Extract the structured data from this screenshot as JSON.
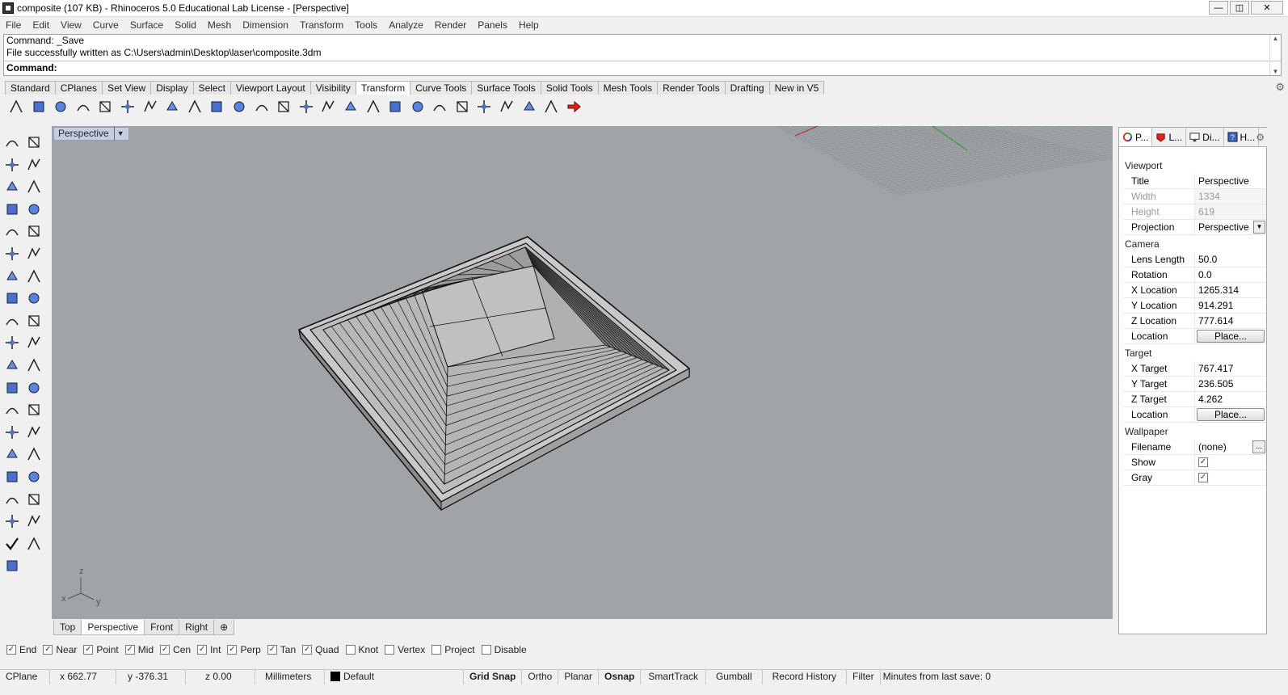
{
  "window": {
    "title": "composite (107 KB) - Rhinoceros 5.0 Educational Lab License - [Perspective]",
    "buttons": [
      "—",
      "◫",
      "✕"
    ]
  },
  "menu": [
    "File",
    "Edit",
    "View",
    "Curve",
    "Surface",
    "Solid",
    "Mesh",
    "Dimension",
    "Transform",
    "Tools",
    "Analyze",
    "Render",
    "Panels",
    "Help"
  ],
  "command": {
    "history": [
      "Command: _Save",
      "File successfully written as C:\\Users\\admin\\Desktop\\laser\\composite.3dm"
    ],
    "prompt": "Command:"
  },
  "toolbar_tabs": [
    "Standard",
    "CPlanes",
    "Set View",
    "Display",
    "Select",
    "Viewport Layout",
    "Visibility",
    "Transform",
    "Curve Tools",
    "Surface Tools",
    "Solid Tools",
    "Mesh Tools",
    "Render Tools",
    "Drafting",
    "New in V5"
  ],
  "toolbar_active_tab": "Transform",
  "transform_icons": [
    "move-icon",
    "scale-icon",
    "array-icon",
    "mirror-icon",
    "rotate-3d-icon",
    "align-icon",
    "shear-icon",
    "cage-edit-icon",
    "twist-icon",
    "orient-icon",
    "taper-icon",
    "bend-icon",
    "array-rect-icon",
    "array-polar-icon",
    "smash-icon",
    "array-curve-icon",
    "scale-1d-icon",
    "flow-icon",
    "splop-icon",
    "stretch-icon",
    "taper-curve-icon",
    "twist-surface-icon",
    "flow-surface-icon",
    "cage-icon",
    "control-points-icon",
    "arrow-red-icon"
  ],
  "left_tools": [
    "select-icon",
    "select-points-icon",
    "point-icon",
    "point-cloud-icon",
    "polyline-icon",
    "curve-icon",
    "arc-icon",
    "circle-icon",
    "ellipse-icon",
    "polygon-icon",
    "rectangle-icon",
    "polygon-star-icon",
    "fillet-curve-icon",
    "surface-pt-icon",
    "extrude-icon",
    "box-icon",
    "sphere-icon",
    "cylinder-icon",
    "mesh-plane-icon",
    "gear-tool-icon",
    "boolean-icon",
    "boolean-union-icon",
    "split-icon",
    "join-icon",
    "explode-icon",
    "extend-icon",
    "fillet-icon",
    "text-icon",
    "transform-icon",
    "group-icon",
    "analyze-icon",
    "render-icon",
    "grid-icon",
    "array-tool-icon",
    "dimension-icon",
    "surface-tool-icon",
    "check-icon",
    "solid-tool-icon",
    "light-icon"
  ],
  "viewport": {
    "label": "Perspective",
    "axes": [
      "z",
      "x",
      "y"
    ]
  },
  "view_tabs": [
    "Top",
    "Perspective",
    "Front",
    "Right"
  ],
  "view_active": "Perspective",
  "osnaps": [
    {
      "label": "End",
      "checked": true
    },
    {
      "label": "Near",
      "checked": true
    },
    {
      "label": "Point",
      "checked": true
    },
    {
      "label": "Mid",
      "checked": true
    },
    {
      "label": "Cen",
      "checked": true
    },
    {
      "label": "Int",
      "checked": true
    },
    {
      "label": "Perp",
      "checked": true
    },
    {
      "label": "Tan",
      "checked": true
    },
    {
      "label": "Quad",
      "checked": true
    },
    {
      "label": "Knot",
      "checked": false
    },
    {
      "label": "Vertex",
      "checked": false
    },
    {
      "label": "Project",
      "checked": false
    },
    {
      "label": "Disable",
      "checked": false
    }
  ],
  "status": {
    "cplane": "CPlane",
    "x": "x 662.77",
    "y": "y -376.31",
    "z": "z 0.00",
    "units": "Millimeters",
    "layer": "Default",
    "toggles": [
      "Grid Snap",
      "Ortho",
      "Planar",
      "Osnap",
      "SmartTrack",
      "Gumball",
      "Record History",
      "Filter"
    ],
    "bold_toggles": [
      "Grid Snap",
      "Osnap"
    ],
    "save_info": "Minutes from last save: 0"
  },
  "panel": {
    "tabs": [
      "P...",
      "L...",
      "Di...",
      "H..."
    ],
    "viewport": {
      "heading": "Viewport",
      "title_label": "Title",
      "title_value": "Perspective",
      "width_label": "Width",
      "width_value": "1334",
      "height_label": "Height",
      "height_value": "619",
      "projection_label": "Projection",
      "projection_value": "Perspective"
    },
    "camera": {
      "heading": "Camera",
      "lens_label": "Lens Length",
      "lens_value": "50.0",
      "rotation_label": "Rotation",
      "rotation_value": "0.0",
      "xloc_label": "X Location",
      "xloc_value": "1265.314",
      "yloc_label": "Y Location",
      "yloc_value": "914.291",
      "zloc_label": "Z Location",
      "zloc_value": "777.614",
      "location_label": "Location",
      "place_button": "Place..."
    },
    "target": {
      "heading": "Target",
      "x_label": "X Target",
      "x_value": "767.417",
      "y_label": "Y Target",
      "y_value": "236.505",
      "z_label": "Z Target",
      "z_value": "4.262",
      "location_label": "Location",
      "place_button": "Place..."
    },
    "wallpaper": {
      "heading": "Wallpaper",
      "filename_label": "Filename",
      "filename_value": "(none)",
      "dots": "...",
      "show_label": "Show",
      "show_checked": true,
      "gray_label": "Gray",
      "gray_checked": true
    }
  }
}
